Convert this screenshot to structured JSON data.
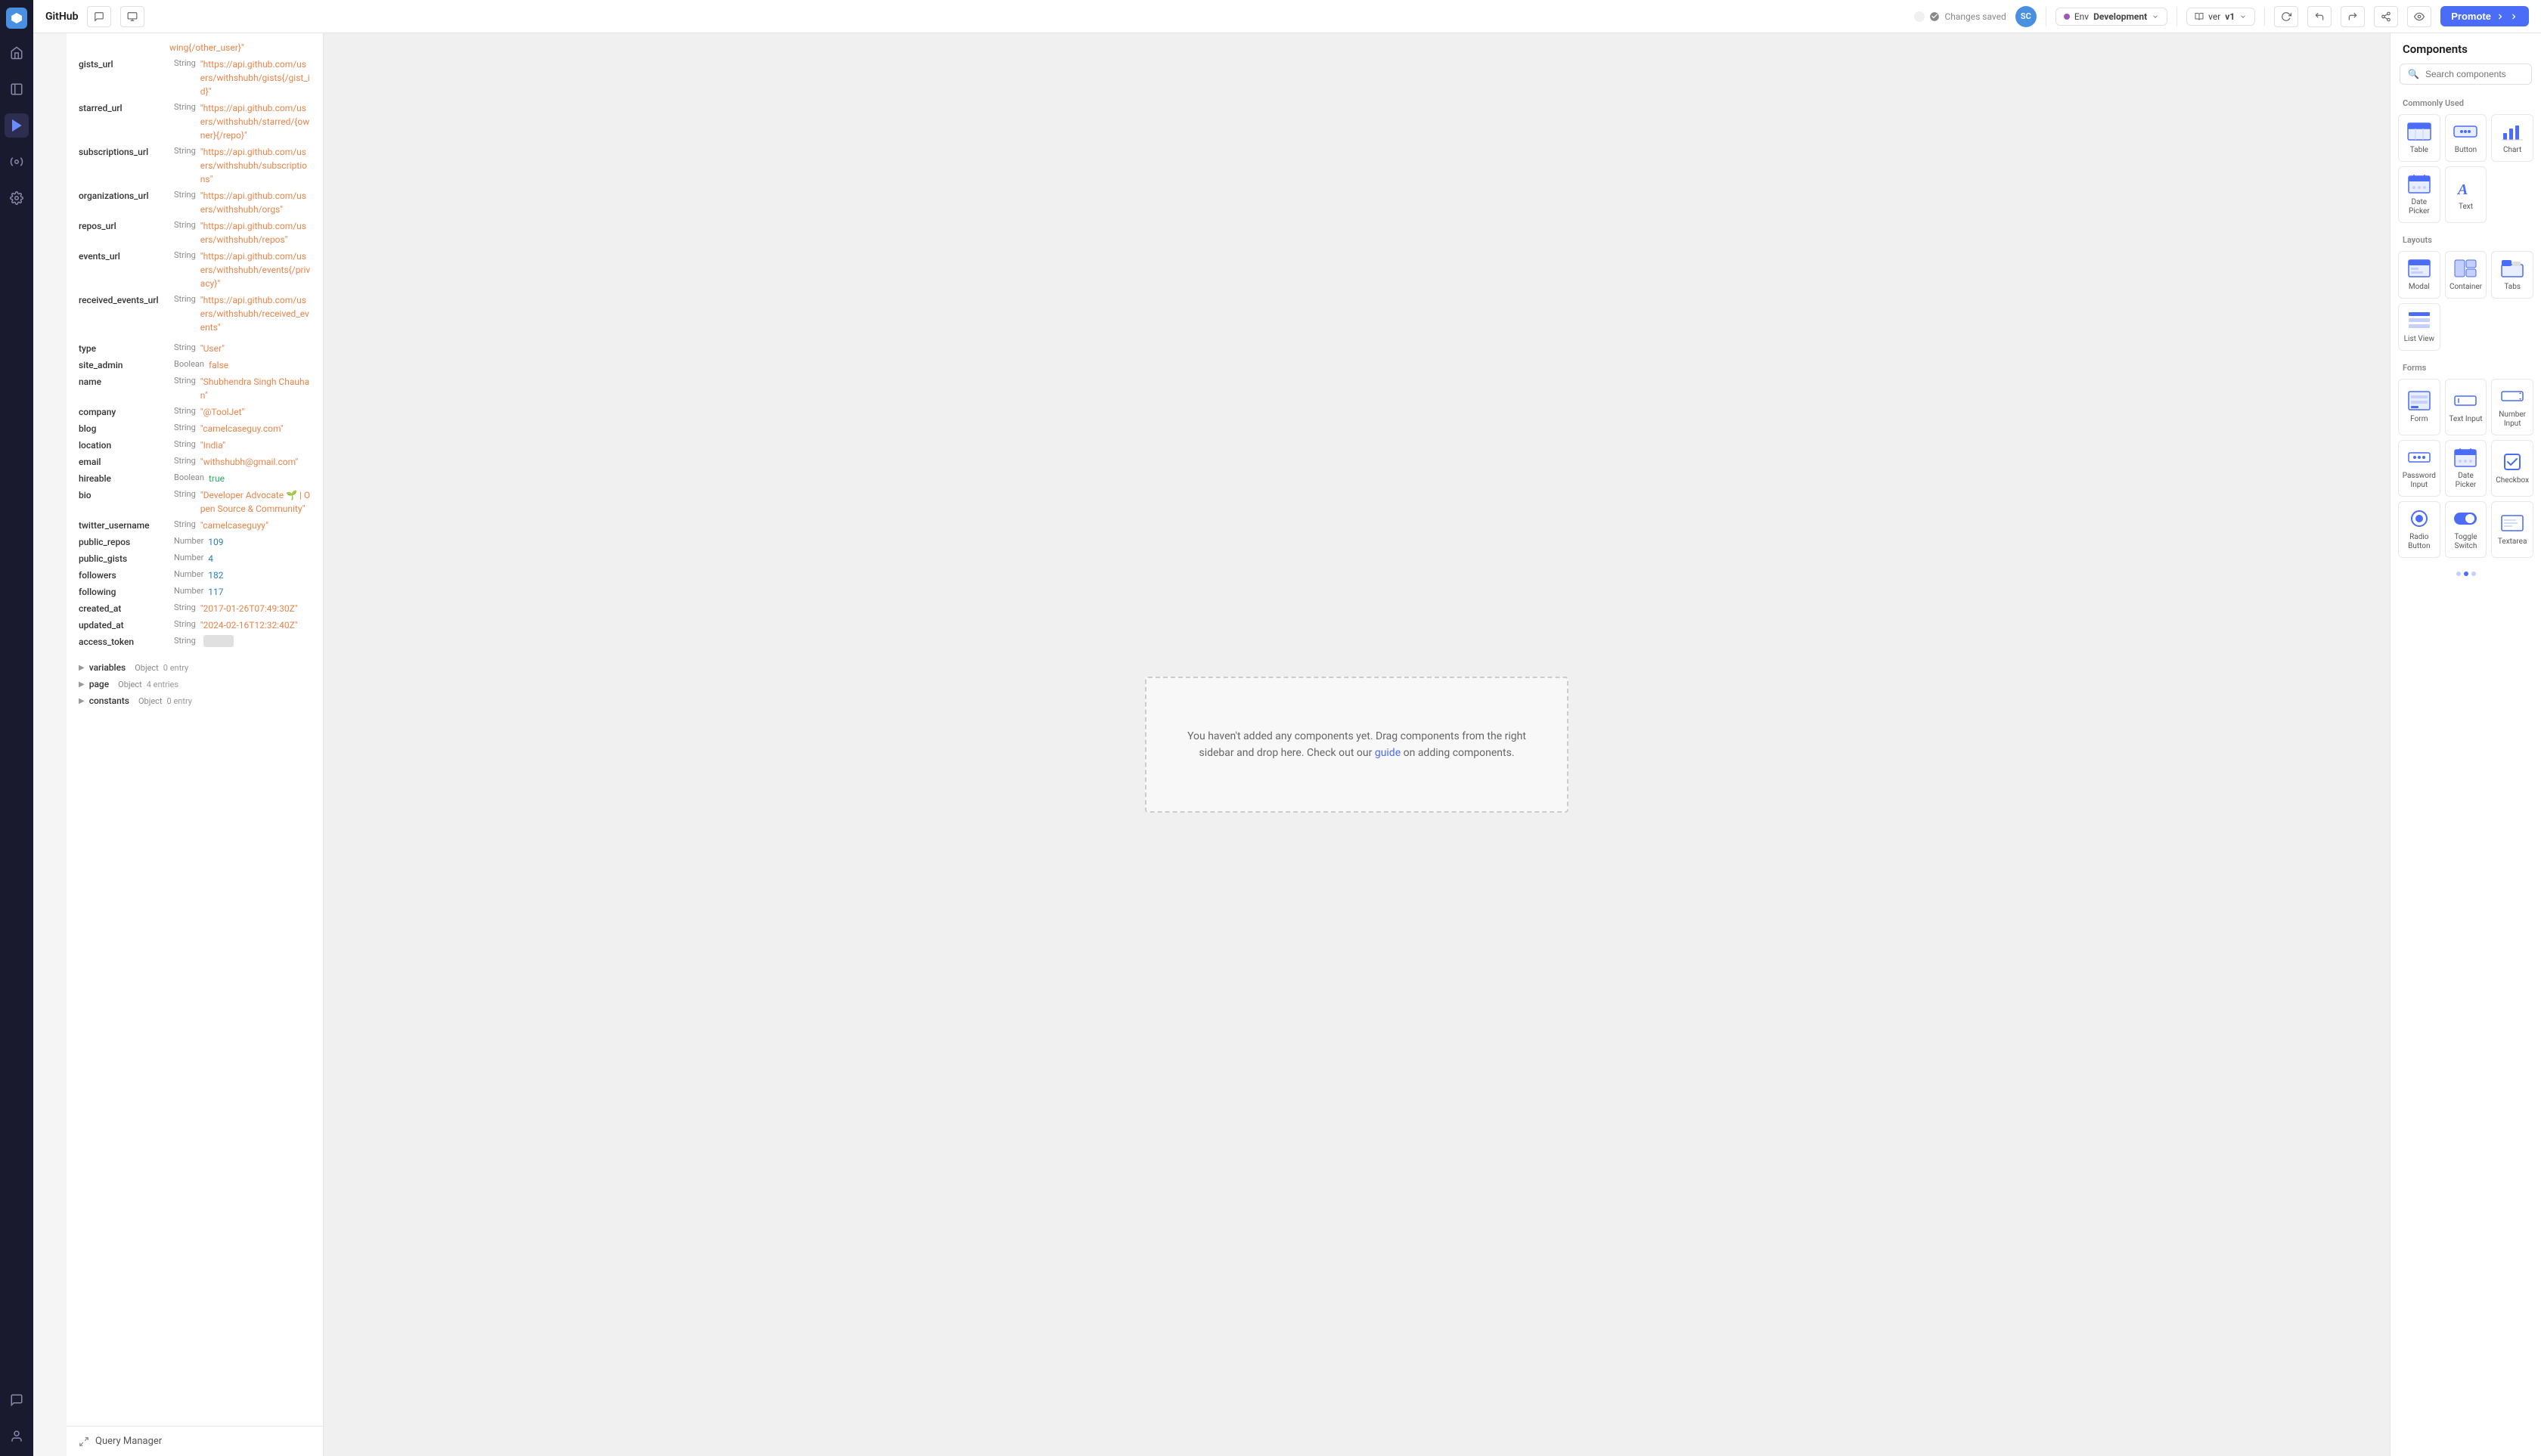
{
  "header": {
    "title": "GitHub",
    "changes_saved": "Changes saved",
    "avatar": "SC",
    "env_label": "Env",
    "env_value": "Development",
    "ver_label": "ver",
    "ver_value": "v1",
    "promote_label": "Promote"
  },
  "nav": {
    "items": [
      {
        "name": "home",
        "icon": "rocket",
        "active": false
      },
      {
        "name": "pages",
        "icon": "file",
        "active": false
      },
      {
        "name": "ui-builder",
        "icon": "cursor",
        "active": true
      },
      {
        "name": "plugins",
        "icon": "puzzle",
        "active": false
      },
      {
        "name": "settings",
        "icon": "gear",
        "active": false
      },
      {
        "name": "chat",
        "icon": "message",
        "active": false
      },
      {
        "name": "profile",
        "icon": "user",
        "active": false
      }
    ]
  },
  "data_tree": {
    "rows": [
      {
        "key": "gists_url",
        "type": "String",
        "val": "\"https://api.github.com/users/withshubh/gists{/gist_id}\""
      },
      {
        "key": "starred_url",
        "type": "String",
        "val": "\"https://api.github.com/users/withshubh/starred/{owner}{/repo}\""
      },
      {
        "key": "subscriptions_url",
        "type": "String",
        "val": "\"https://api.github.com/users/withshubh/subscriptions\""
      },
      {
        "key": "organizations_url",
        "type": "String",
        "val": "\"https://api.github.com/users/withshubh/orgs\""
      },
      {
        "key": "repos_url",
        "type": "String",
        "val": "\"https://api.github.com/users/withshubh/repos\""
      },
      {
        "key": "events_url",
        "type": "String",
        "val": "\"https://api.github.com/users/withshubh/events{/privacy}\""
      },
      {
        "key": "received_events_url",
        "type": "String",
        "val": "\"https://api.github.com/users/withshubh/received_events\""
      },
      {
        "key": "type",
        "type": "String",
        "val": "\"User\"",
        "val_class": ""
      },
      {
        "key": "site_admin",
        "type": "Boolean",
        "val": "false",
        "val_class": "bool-false"
      },
      {
        "key": "name",
        "type": "String",
        "val": "\"Shubhendra Singh Chauhan\""
      },
      {
        "key": "company",
        "type": "String",
        "val": "\"@ToolJet\""
      },
      {
        "key": "blog",
        "type": "String",
        "val": "\"camelcaseguy.com\""
      },
      {
        "key": "location",
        "type": "String",
        "val": "\"India\""
      },
      {
        "key": "email",
        "type": "String",
        "val": "\"withshubh@gmail.com\""
      },
      {
        "key": "hireable",
        "type": "Boolean",
        "val": "true",
        "val_class": "bool-true"
      },
      {
        "key": "bio",
        "type": "String",
        "val": "\"Developer Advocate 🌱 | Open Source & Community\""
      },
      {
        "key": "twitter_username",
        "type": "String",
        "val": "\"camelcaseguyy\""
      },
      {
        "key": "public_repos",
        "type": "Number",
        "val": "109",
        "val_class": "num"
      },
      {
        "key": "public_gists",
        "type": "Number",
        "val": "4",
        "val_class": "num"
      },
      {
        "key": "followers",
        "type": "Number",
        "val": "182",
        "val_class": "num"
      },
      {
        "key": "following",
        "type": "Number",
        "val": "117",
        "val_class": "num"
      },
      {
        "key": "created_at",
        "type": "String",
        "val": "\"2017-01-26T07:49:30Z\""
      },
      {
        "key": "updated_at",
        "type": "String",
        "val": "\"2024-02-16T12:32:40Z\""
      },
      {
        "key": "access_token",
        "type": "String",
        "val": "••••••••••"
      }
    ],
    "sections": [
      {
        "key": "variables",
        "type": "Object",
        "count": "0 entry",
        "expanded": false
      },
      {
        "key": "page",
        "type": "Object",
        "count": "4 entries",
        "expanded": false
      },
      {
        "key": "constants",
        "type": "Object",
        "count": "0 entry",
        "expanded": false
      }
    ]
  },
  "canvas": {
    "placeholder_text": "You haven't added any components yet. Drag components from the right sidebar and drop here. Check out our",
    "placeholder_link": "guide",
    "placeholder_suffix": "on adding components."
  },
  "components_panel": {
    "title": "Components",
    "search_placeholder": "Search components",
    "sections": [
      {
        "label": "Commonly Used",
        "items": [
          {
            "name": "Table",
            "icon": "table"
          },
          {
            "name": "Button",
            "icon": "button"
          },
          {
            "name": "Chart",
            "icon": "chart"
          },
          {
            "name": "Date Picker",
            "icon": "datepicker"
          },
          {
            "name": "Text",
            "icon": "text"
          }
        ]
      },
      {
        "label": "Layouts",
        "items": [
          {
            "name": "Modal",
            "icon": "modal"
          },
          {
            "name": "Container",
            "icon": "container"
          },
          {
            "name": "Tabs",
            "icon": "tabs"
          },
          {
            "name": "List View",
            "icon": "listview"
          }
        ]
      },
      {
        "label": "Forms",
        "items": [
          {
            "name": "Form",
            "icon": "form"
          },
          {
            "name": "Text Input",
            "icon": "textinput"
          },
          {
            "name": "Number Input",
            "icon": "numberinput"
          },
          {
            "name": "Password Input",
            "icon": "pwdinput"
          },
          {
            "name": "Date Picker",
            "icon": "datepicker2"
          },
          {
            "name": "Checkbox",
            "icon": "checkbox"
          },
          {
            "name": "Radio Button",
            "icon": "radio"
          },
          {
            "name": "Toggle Switch",
            "icon": "toggle"
          },
          {
            "name": "Textarea",
            "icon": "textarea"
          }
        ]
      }
    ]
  },
  "query_manager": {
    "label": "Query Manager"
  }
}
